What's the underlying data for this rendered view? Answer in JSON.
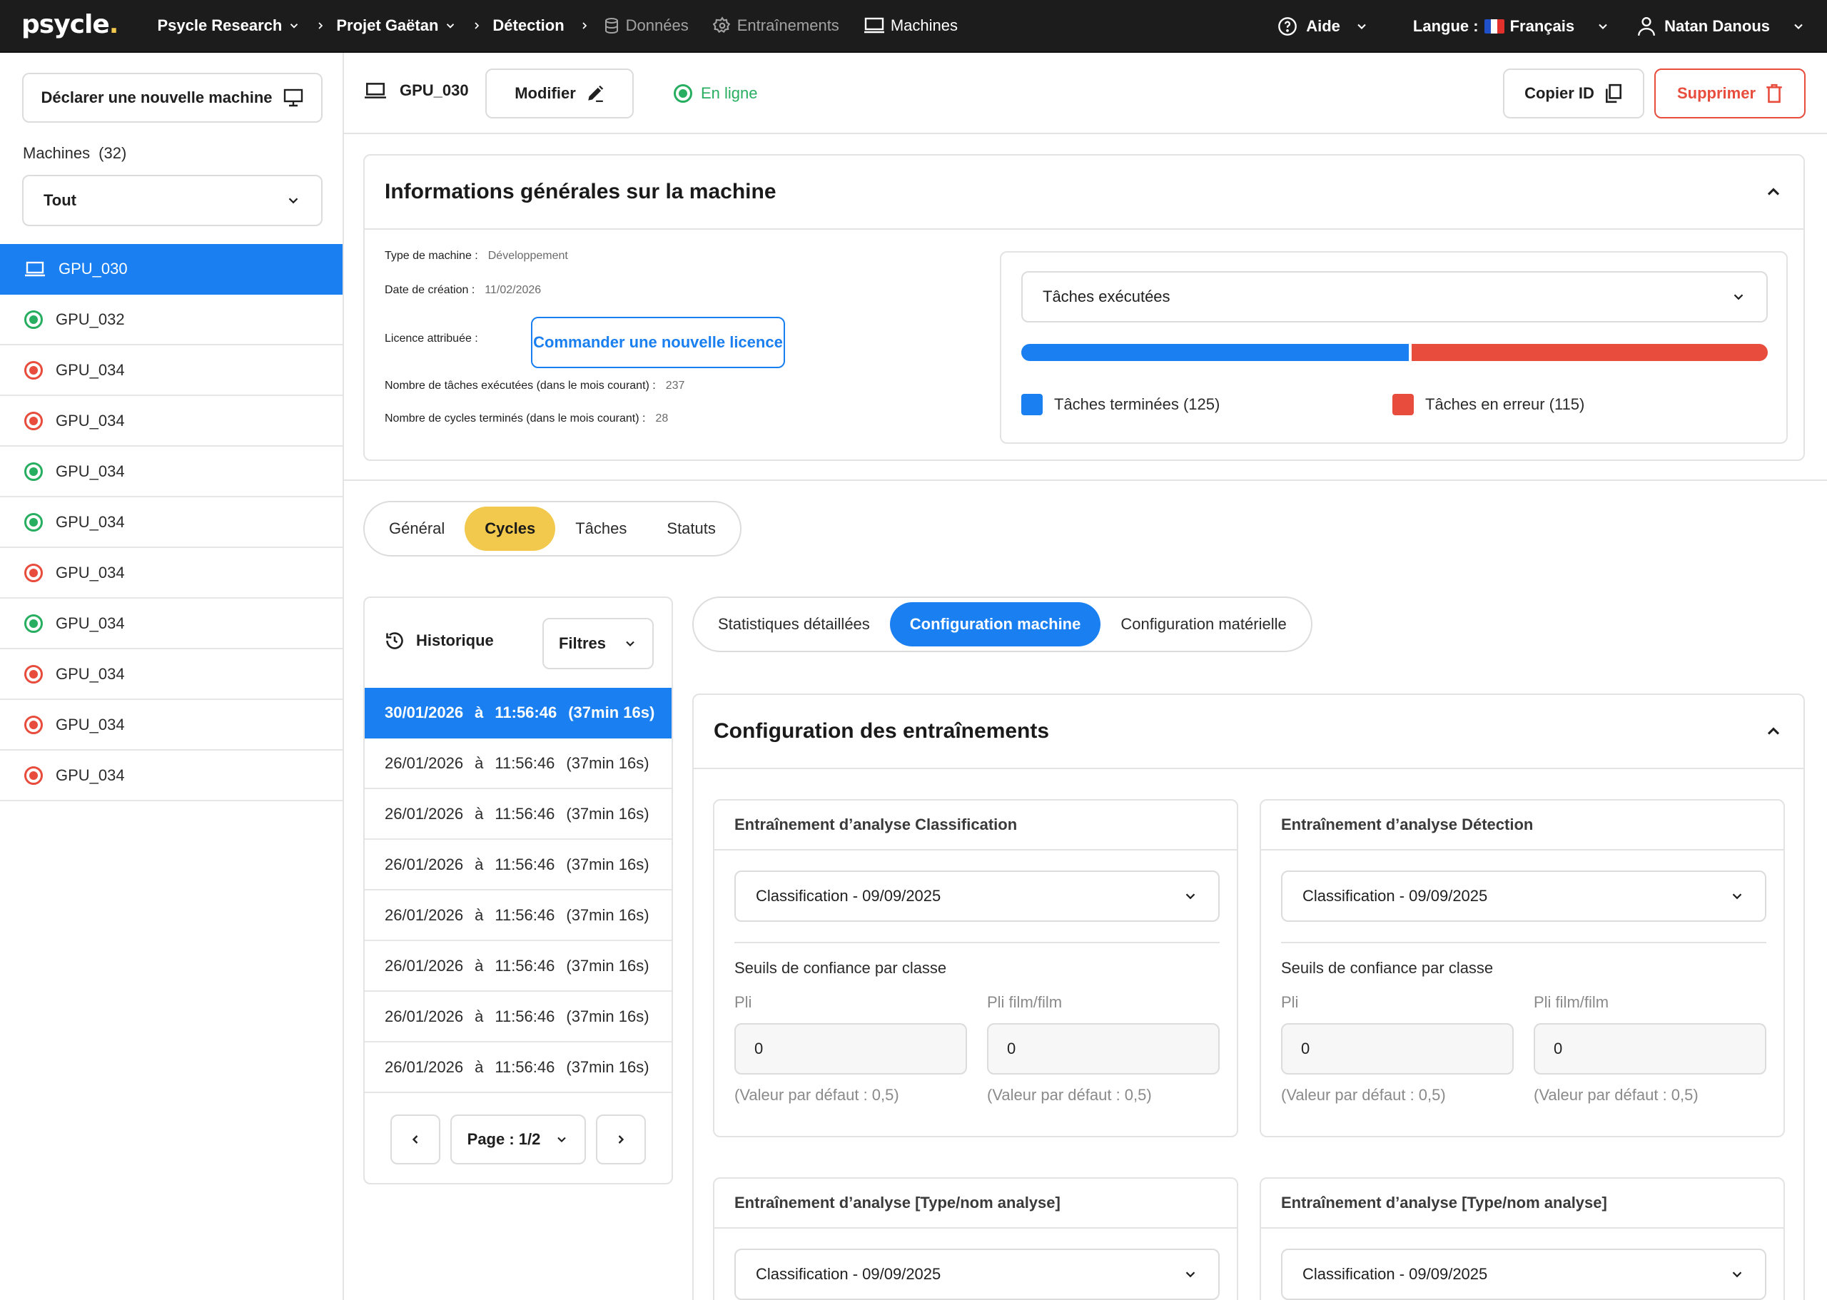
{
  "topbar": {
    "logo": "psycle",
    "logo_dot": ".",
    "breadcrumbs": [
      "Psycle Research",
      "Projet Gaëtan",
      "Détection"
    ],
    "nav": [
      "Données",
      "Entraînements",
      "Machines"
    ],
    "help": "Aide",
    "language_label": "Langue :",
    "language_value": "Français",
    "user": "Natan Danous",
    "icons": [
      "chevron-down-icon",
      "chevron-right-icon",
      "database-icon",
      "gear-icon",
      "monitor-icon",
      "help-circle-icon",
      "flag-fr-icon",
      "user-icon"
    ]
  },
  "sidebar": {
    "declare_label": "Déclarer une nouvelle machine",
    "machines_label": "Machines",
    "machines_count": "(32)",
    "filter_value": "Tout",
    "items": [
      {
        "name": "GPU_030",
        "status": "active"
      },
      {
        "name": "GPU_032",
        "status": "online"
      },
      {
        "name": "GPU_034",
        "status": "offline"
      },
      {
        "name": "GPU_034",
        "status": "offline"
      },
      {
        "name": "GPU_034",
        "status": "online"
      },
      {
        "name": "GPU_034",
        "status": "online"
      },
      {
        "name": "GPU_034",
        "status": "offline"
      },
      {
        "name": "GPU_034",
        "status": "online"
      },
      {
        "name": "GPU_034",
        "status": "offline"
      },
      {
        "name": "GPU_034",
        "status": "offline"
      },
      {
        "name": "GPU_034",
        "status": "offline"
      }
    ]
  },
  "machine": {
    "name": "GPU_030",
    "modify_label": "Modifier",
    "status_label": "En ligne",
    "copy_id_label": "Copier ID",
    "delete_label": "Supprimer"
  },
  "info": {
    "title": "Informations générales sur la machine",
    "type_label": "Type de machine :",
    "type_value": "Développement",
    "date_label": "Date de création :",
    "date_value": "11/02/2026",
    "licence_label": "Licence attribuée :",
    "licence_button": "Commander une nouvelle licence",
    "tasks_label": "Nombre de tâches exécutées (dans le mois courant) :",
    "tasks_value": "237",
    "cycles_label": "Nombre de cycles terminés (dans le mois courant) :",
    "cycles_value": "28",
    "tasks_select": "Tâches exécutées",
    "done_label": "Tâches terminées (125)",
    "done_count": 125,
    "error_label": "Tâches en erreur (115)",
    "error_count": 115
  },
  "main_tabs": {
    "items": [
      "Général",
      "Cycles",
      "Tâches",
      "Statuts"
    ],
    "active": "Cycles"
  },
  "history": {
    "title": "Historique",
    "filters_label": "Filtres",
    "items": [
      {
        "date": "30/01/2026",
        "sep": "à",
        "time": "11:56:46",
        "duration": "(37min 16s)",
        "active": true
      },
      {
        "date": "26/01/2026",
        "sep": "à",
        "time": "11:56:46",
        "duration": "(37min 16s)"
      },
      {
        "date": "26/01/2026",
        "sep": "à",
        "time": "11:56:46",
        "duration": "(37min 16s)"
      },
      {
        "date": "26/01/2026",
        "sep": "à",
        "time": "11:56:46",
        "duration": "(37min 16s)"
      },
      {
        "date": "26/01/2026",
        "sep": "à",
        "time": "11:56:46",
        "duration": "(37min 16s)"
      },
      {
        "date": "26/01/2026",
        "sep": "à",
        "time": "11:56:46",
        "duration": "(37min 16s)"
      },
      {
        "date": "26/01/2026",
        "sep": "à",
        "time": "11:56:46",
        "duration": "(37min 16s)"
      },
      {
        "date": "26/01/2026",
        "sep": "à",
        "time": "11:56:46",
        "duration": "(37min 16s)"
      }
    ],
    "page_label": "Page : 1/2"
  },
  "sub_tabs": {
    "items": [
      "Statistiques détaillées",
      "Configuration machine",
      "Configuration matérielle"
    ],
    "active": "Configuration machine"
  },
  "training": {
    "title": "Configuration des entraînements",
    "cards": [
      {
        "title": "Entraînement d’analyse Classification",
        "select": "Classification - 09/09/2025",
        "seuils": "Seuils de confiance par classe",
        "field1_label": "Pli",
        "field1_value": "0",
        "field1_hint": "(Valeur par défaut : 0,5)",
        "field2_label": "Pli film/film",
        "field2_value": "0",
        "field2_hint": "(Valeur par défaut : 0,5)"
      },
      {
        "title": "Entraînement d’analyse Détection",
        "select": "Classification - 09/09/2025",
        "seuils": "Seuils de confiance par classe",
        "field1_label": "Pli",
        "field1_value": "0",
        "field1_hint": "(Valeur par défaut : 0,5)",
        "field2_label": "Pli film/film",
        "field2_value": "0",
        "field2_hint": "(Valeur par défaut : 0,5)"
      },
      {
        "title": "Entraînement d’analyse [Type/nom analyse]",
        "select": "Classification - 09/09/2025"
      },
      {
        "title": "Entraînement d’analyse [Type/nom analyse]",
        "select": "Classification - 09/09/2025"
      }
    ]
  },
  "colors": {
    "primary": "#1a7ff0",
    "accent": "#f2c94c",
    "success": "#27ae60",
    "danger": "#e74c3c",
    "topbar": "#1c1c1c"
  }
}
